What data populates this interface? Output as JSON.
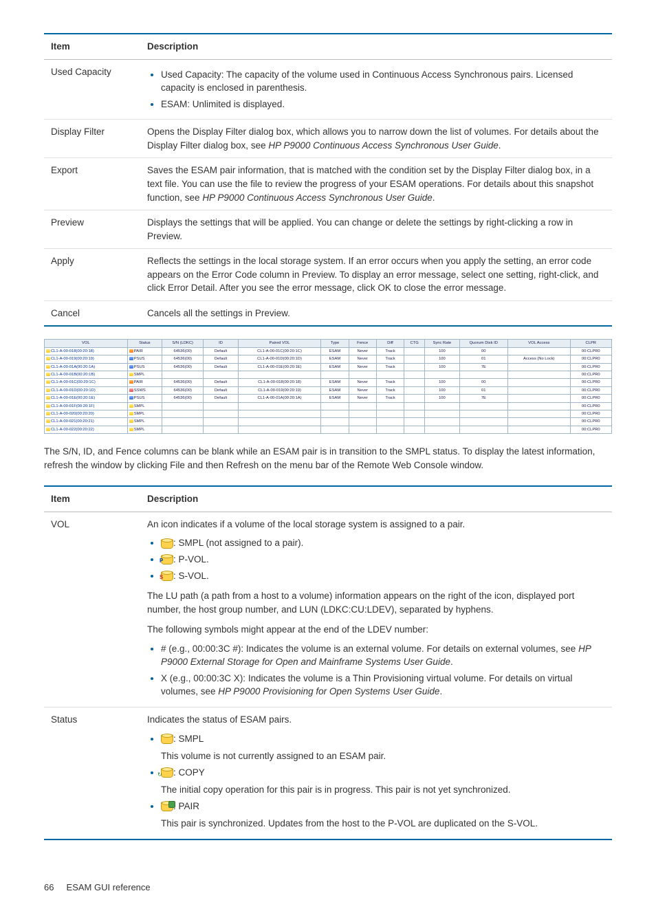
{
  "table1": {
    "headers": {
      "item": "Item",
      "desc": "Description"
    },
    "rows": [
      {
        "item": "Used Capacity",
        "list": [
          "Used Capacity: The capacity of the volume used in Continuous Access Synchronous pairs. Licensed capacity is enclosed in parenthesis.",
          "ESAM: Unlimited is displayed."
        ]
      },
      {
        "item": "Display Filter",
        "text_parts": [
          "Opens the Display Filter dialog box, which allows you to narrow down the list of volumes. For details about the Display Filter dialog box, see ",
          "HP P9000 Continuous Access Synchronous User Guide",
          "."
        ]
      },
      {
        "item": "Export",
        "text_parts": [
          "Saves the ESAM pair information, that is matched with the condition set by the Display Filter dialog box, in a text file. You can use the file to review the progress of your ESAM operations. For details about this snapshot function, see ",
          "HP P9000 Continuous Access Synchronous User Guide",
          "."
        ]
      },
      {
        "item": "Preview",
        "text": "Displays the settings that will be applied. You can change or delete the settings by right-clicking a row in Preview."
      },
      {
        "item": "Apply",
        "text": "Reflects the settings in the local storage system. If an error occurs when you apply the setting, an error code appears on the Error Code column in Preview. To display an error message, select one setting, right-click, and click Error Detail. After you see the error message, click OK to close the error message."
      },
      {
        "item": "Cancel",
        "text": "Cancels all the settings in Preview."
      }
    ]
  },
  "grid": {
    "headers": [
      "VOL",
      "Status",
      "S/N (LDKC)",
      "ID",
      "Paired VOL",
      "Type",
      "Fence",
      "Diff",
      "CTG",
      "Sync Rate",
      "Quorum Disk ID",
      "VOL Access",
      "CLPR"
    ],
    "rows": [
      {
        "vol": "CL1-A-00-018(00:20:18)",
        "status": "PAIR",
        "sicon": "g-pair",
        "sn": "64536(00)",
        "id": "Default",
        "pvol": "CL1-A-00-01C(00:20:1C)",
        "type": "ESAM",
        "fence": "Never",
        "diff": "Track",
        "ctg": "",
        "sync": "100",
        "qd": "00",
        "va": "",
        "clpr": "00:CLPR0"
      },
      {
        "vol": "CL1-A-00-019(00:20:19)",
        "status": "PSUS",
        "sicon": "g-psus",
        "sn": "64536(00)",
        "id": "Default",
        "pvol": "CL1-A-00-01D(00:20:1D)",
        "type": "ESAM",
        "fence": "Never",
        "diff": "Track",
        "ctg": "",
        "sync": "100",
        "qd": "01",
        "va": "Access (No Lock)",
        "clpr": "00:CLPR0"
      },
      {
        "vol": "CL1-A-00-01A(00:20:1A)",
        "status": "PSUS",
        "sicon": "g-psus",
        "sn": "64536(00)",
        "id": "Default",
        "pvol": "CL1-A-00-01E(00:20:1E)",
        "type": "ESAM",
        "fence": "Never",
        "diff": "Track",
        "ctg": "",
        "sync": "100",
        "qd": "7E",
        "va": "",
        "clpr": "00:CLPR0"
      },
      {
        "vol": "CL1-A-00-01B(00:20:1B)",
        "status": "SMPL",
        "sicon": "g-smpl",
        "sn": "",
        "id": "",
        "pvol": "",
        "type": "",
        "fence": "",
        "diff": "",
        "ctg": "",
        "sync": "",
        "qd": "",
        "va": "",
        "clpr": "00:CLPR0"
      },
      {
        "vol": "CL1-A-00-01C(00:20:1C)",
        "status": "PAIR",
        "sicon": "g-pair",
        "sn": "64536(00)",
        "id": "Default",
        "pvol": "CL1-A-00-018(00:20:18)",
        "type": "ESAM",
        "fence": "Never",
        "diff": "Track",
        "ctg": "",
        "sync": "100",
        "qd": "00",
        "va": "",
        "clpr": "00:CLPR0"
      },
      {
        "vol": "CL1-A-00-01D(00:20:1D)",
        "status": "SSWS",
        "sicon": "g-ssws",
        "sn": "64536(00)",
        "id": "Default",
        "pvol": "CL1-A-00-019(00:20:19)",
        "type": "ESAM",
        "fence": "Never",
        "diff": "Track",
        "ctg": "",
        "sync": "100",
        "qd": "01",
        "va": "",
        "clpr": "00:CLPR0"
      },
      {
        "vol": "CL1-A-00-01E(00:20:1E)",
        "status": "PSUS",
        "sicon": "g-psus",
        "sn": "64536(00)",
        "id": "Default",
        "pvol": "CL1-A-00-01A(00:20:1A)",
        "type": "ESAM",
        "fence": "Never",
        "diff": "Track",
        "ctg": "",
        "sync": "100",
        "qd": "7E",
        "va": "",
        "clpr": "00:CLPR0"
      },
      {
        "vol": "CL1-A-00-01F(00:20:1F)",
        "status": "SMPL",
        "sicon": "g-smpl",
        "sn": "",
        "id": "",
        "pvol": "",
        "type": "",
        "fence": "",
        "diff": "",
        "ctg": "",
        "sync": "",
        "qd": "",
        "va": "",
        "clpr": "00:CLPR0"
      },
      {
        "vol": "CL1-A-00-020(00:20:20)",
        "status": "SMPL",
        "sicon": "g-smpl",
        "sn": "",
        "id": "",
        "pvol": "",
        "type": "",
        "fence": "",
        "diff": "",
        "ctg": "",
        "sync": "",
        "qd": "",
        "va": "",
        "clpr": "00:CLPR0"
      },
      {
        "vol": "CL1-A-00-021(00:20:21)",
        "status": "SMPL",
        "sicon": "g-smpl",
        "sn": "",
        "id": "",
        "pvol": "",
        "type": "",
        "fence": "",
        "diff": "",
        "ctg": "",
        "sync": "",
        "qd": "",
        "va": "",
        "clpr": "00:CLPR0"
      },
      {
        "vol": "CL1-A-00-022(00:20:22)",
        "status": "SMPL",
        "sicon": "g-smpl",
        "sn": "",
        "id": "",
        "pvol": "",
        "type": "",
        "fence": "",
        "diff": "",
        "ctg": "",
        "sync": "",
        "qd": "",
        "va": "",
        "clpr": "00:CLPR0"
      }
    ]
  },
  "midtext": "The S/N, ID, and Fence columns can be blank while an ESAM pair is in transition to the SMPL status. To display the latest information, refresh the window by clicking File and then Refresh on the menu bar of the Remote Web Console window.",
  "table2": {
    "headers": {
      "item": "Item",
      "desc": "Description"
    },
    "vol": {
      "item": "VOL",
      "intro": "An icon indicates if a volume of the local storage system is assigned to a pair.",
      "icons": [
        {
          "kind": "smpl",
          "label": ": SMPL (not assigned to a pair)."
        },
        {
          "kind": "pvol",
          "label": ": P-VOL."
        },
        {
          "kind": "svol",
          "label": ": S-VOL."
        }
      ],
      "lupath": "The LU path (a path from a host to a volume) information appears on the right of the icon, displayed port number, the host group number, and LUN (LDKC:CU:LDEV), separated by hyphens.",
      "symintro": "The following symbols might appear at the end of the LDEV number:",
      "symbols": [
        {
          "pre": "# (e.g., 00:00:3C #): Indicates the volume is an external volume. For details on external volumes, see ",
          "ital": "HP P9000 External Storage for Open and Mainframe Systems User Guide",
          "post": "."
        },
        {
          "pre": "X (e.g., 00:00:3C X): Indicates the volume is a Thin Provisioning virtual volume. For details on virtual volumes, see ",
          "ital": "HP P9000 Provisioning for Open Systems User Guide",
          "post": "."
        }
      ]
    },
    "status": {
      "item": "Status",
      "intro": "Indicates the status of ESAM pairs.",
      "items": [
        {
          "kind": "smpl",
          "label": ": SMPL",
          "text": "This volume is not currently assigned to an ESAM pair."
        },
        {
          "kind": "copy",
          "label": ": COPY",
          "text": "The initial copy operation for this pair is in progress. This pair is not yet synchronized."
        },
        {
          "kind": "pair",
          "label": ": PAIR",
          "text": "This pair is synchronized. Updates from the host to the P-VOL are duplicated on the S-VOL."
        }
      ]
    }
  },
  "footer": {
    "page": "66",
    "title": "ESAM GUI reference"
  }
}
